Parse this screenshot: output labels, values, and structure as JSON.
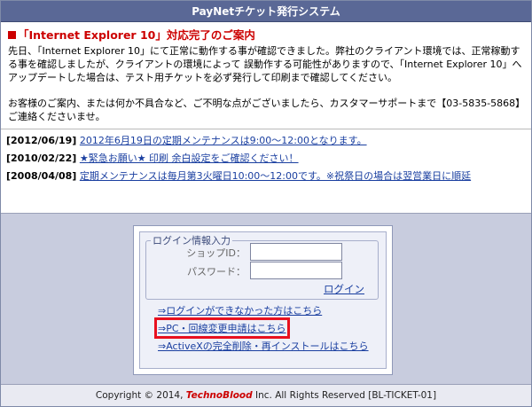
{
  "header": {
    "title": "PayNetチケット発行システム"
  },
  "notice": {
    "title": "「Internet Explorer 10」対応完了のご案内",
    "para1": "先日、「Internet Explorer 10」にて正常に動作する事が確認できました。弊社のクライアント環境では、正常稼動する事を確認しましたが、クライアントの環境によって 誤動作する可能性がありますので、「Internet Explorer 10」へアップデートした場合は、テスト用チケットを必ず発行して印刷まで確認してください。",
    "para2": "お客様のご案内、または何か不具合など、ご不明な点がございましたら、カスタマーサポートまで【03-5835-5868】ご連絡くださいませ。"
  },
  "news": [
    {
      "date": "[2012/06/19]",
      "text": "2012年6月19日の定期メンテナンスは9:00～12:00となります。"
    },
    {
      "date": "[2010/02/22]",
      "text": "★緊急お願い★ 印刷 余白設定をご確認ください！"
    },
    {
      "date": "[2008/04/08]",
      "text": "定期メンテナンスは毎月第3火曜日10:00～12:00です。※祝祭日の場合は翌営業日に順延"
    }
  ],
  "login": {
    "section_label": "ログイン情報入力",
    "shop_id_label": "ショップID：",
    "password_label": "パスワード：",
    "login_link": "ログイン",
    "links": [
      "⇒ログインができなかった方はこちら",
      "⇒PC・回線変更申請はこちら",
      "⇒ActiveXの完全削除・再インストールはこちら"
    ]
  },
  "footer": {
    "prefix": "Copyright © 2014, ",
    "brand": "TechnoBlood",
    "suffix": " Inc. All Rights Reserved [BL-TICKET-01]"
  }
}
